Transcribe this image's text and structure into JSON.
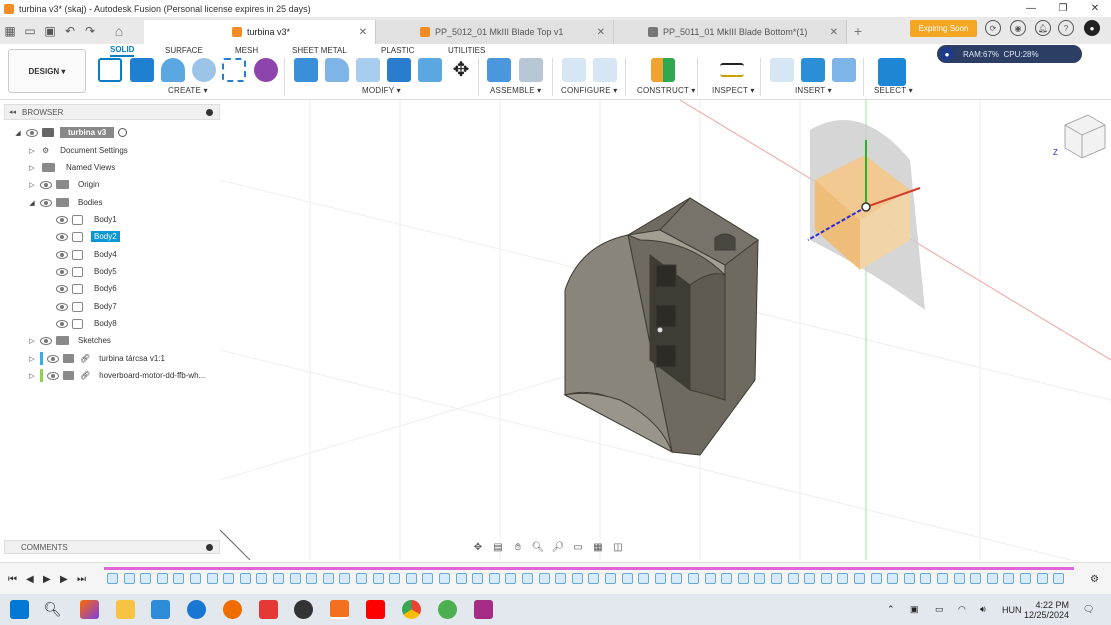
{
  "window": {
    "title": "turbina v3* (skaj) - Autodesk Fusion (Personal license expires in 25 days)",
    "controls": [
      "—",
      "❐",
      "✕"
    ]
  },
  "doc_tabs": [
    {
      "label": "turbina v3*",
      "active": true,
      "icon_color": "#f28c28"
    },
    {
      "label": "PP_5012_01 MkIII Blade Top v1",
      "active": false,
      "icon_color": "#f28c28"
    },
    {
      "label": "PP_5011_01 MkIII Blade Bottom*(1)",
      "active": false,
      "icon_color": "#777777"
    }
  ],
  "expiring_label": "Expiring Soon",
  "design_label": "DESIGN ▾",
  "workspace_tabs": [
    "SOLID",
    "SURFACE",
    "MESH",
    "SHEET METAL",
    "PLASTIC",
    "UTILITIES"
  ],
  "tool_groups": [
    "CREATE ▾",
    "MODIFY ▾",
    "ASSEMBLE ▾",
    "CONFIGURE ▾",
    "CONSTRUCT ▾",
    "INSPECT ▾",
    "INSERT ▾",
    "SELECT ▾"
  ],
  "stats": {
    "ram": "RAM:67%",
    "cpu": "CPU:28%"
  },
  "browser": {
    "header": "BROWSER",
    "root": "turbina v3",
    "items": [
      {
        "label": "Document Settings"
      },
      {
        "label": "Named Views"
      },
      {
        "label": "Origin"
      },
      {
        "label": "Bodies"
      }
    ],
    "bodies": [
      "Body1",
      "Body2",
      "Body4",
      "Body5",
      "Body6",
      "Body7",
      "Body8"
    ],
    "selected_body": "Body2",
    "after": [
      {
        "label": "Sketches"
      },
      {
        "label": "turbina tárcsa v1:1"
      },
      {
        "label": "hoverboard-motor-dd-ffb-wh..."
      }
    ]
  },
  "comments_label": "COMMENTS",
  "taskbar": {
    "lang": "HUN",
    "time": "4:22 PM",
    "date": "12/25/2024"
  },
  "colors": {
    "accent": "#0b96d6",
    "brand": "#f28c28",
    "model": "#6f6a5f"
  }
}
